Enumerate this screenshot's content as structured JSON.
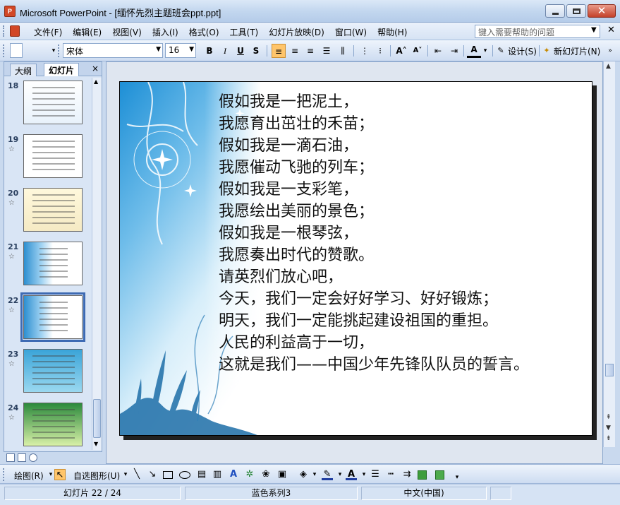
{
  "window": {
    "app_icon_label": "P",
    "title": "Microsoft PowerPoint - [缅怀先烈主题班会ppt.ppt]"
  },
  "menubar": {
    "items": [
      "文件(F)",
      "编辑(E)",
      "视图(V)",
      "插入(I)",
      "格式(O)",
      "工具(T)",
      "幻灯片放映(D)",
      "窗口(W)",
      "帮助(H)"
    ],
    "help_placeholder": "键入需要帮助的问题"
  },
  "toolbar": {
    "font_name": "宋体",
    "font_size": "16",
    "bold": "B",
    "italic": "I",
    "underline": "U",
    "shadow": "S",
    "design_label": "设计(S)",
    "new_slide_label": "新幻灯片(N)"
  },
  "leftpane": {
    "tab_outline": "大纲",
    "tab_slides": "幻灯片",
    "close": "×",
    "slides": [
      {
        "num": "18",
        "star": ""
      },
      {
        "num": "19",
        "star": "☆"
      },
      {
        "num": "20",
        "star": "☆"
      },
      {
        "num": "21",
        "star": "☆"
      },
      {
        "num": "22",
        "star": "☆"
      },
      {
        "num": "23",
        "star": "☆"
      },
      {
        "num": "24",
        "star": "☆"
      }
    ],
    "selected_slide": "22"
  },
  "slide": {
    "lines": [
      "假如我是一把泥土，",
      "我愿育出茁壮的禾苗；",
      "假如我是一滴石油，",
      "我愿催动飞驰的列车；",
      "假如我是一支彩笔，",
      "我愿绘出美丽的景色；",
      "假如我是一根琴弦，",
      "我愿奏出时代的赞歌。",
      "请英烈们放心吧，",
      "今天，我们一定会好好学习、好好锻炼；",
      "明天，我们一定能挑起建设祖国的重担。",
      "人民的利益高于一切，",
      "这就是我们——中国少年先锋队队员的誓言。"
    ]
  },
  "drawbar": {
    "draw_label": "绘图(R)",
    "autoshapes_label": "自选图形(U)"
  },
  "statusbar": {
    "slide_info": "幻灯片 22 / 24",
    "design": "蓝色系列3",
    "language": "中文(中国)"
  },
  "colors": {
    "titlebar": "#c3d7ef",
    "slide_bg_gradient_start": "#1d8fd6",
    "active_button": "#ffc56b"
  }
}
